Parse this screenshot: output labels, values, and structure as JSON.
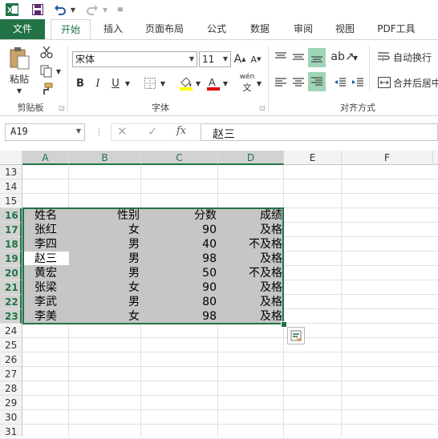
{
  "ribbon_tabs": [
    "文件",
    "开始",
    "插入",
    "页面布局",
    "公式",
    "数据",
    "审阅",
    "视图",
    "PDF工具"
  ],
  "clipboard": {
    "paste_label": "粘贴",
    "group_label": "剪贴板"
  },
  "font": {
    "name": "宋体",
    "size": "11",
    "group_label": "字体",
    "bold": "B",
    "italic": "I",
    "underline": "U",
    "phonetic": "wén"
  },
  "alignment": {
    "wrap_text": "自动换行",
    "merge_center": "合并后居中",
    "group_label": "对齐方式"
  },
  "formula_bar": {
    "name_box": "A19",
    "fx": "fx",
    "value": "赵三"
  },
  "columns": [
    "A",
    "B",
    "C",
    "D",
    "E",
    "F"
  ],
  "rows": [
    "13",
    "14",
    "15",
    "16",
    "17",
    "18",
    "19",
    "20",
    "21",
    "22",
    "23",
    "24",
    "25",
    "26",
    "27",
    "28",
    "29",
    "30",
    "31"
  ],
  "table": {
    "header": [
      "姓名",
      "性别",
      "分数",
      "成绩"
    ],
    "records": [
      [
        "张红",
        "女",
        "90",
        "及格"
      ],
      [
        "李四",
        "男",
        "40",
        "不及格"
      ],
      [
        "赵三",
        "男",
        "98",
        "及格"
      ],
      [
        "黄宏",
        "男",
        "50",
        "不及格"
      ],
      [
        "张梁",
        "女",
        "90",
        "及格"
      ],
      [
        "李武",
        "男",
        "80",
        "及格"
      ],
      [
        "李美",
        "女",
        "98",
        "及格"
      ]
    ]
  },
  "colors": {
    "accent": "#217346",
    "selection_fill": "#c6c6c6"
  }
}
